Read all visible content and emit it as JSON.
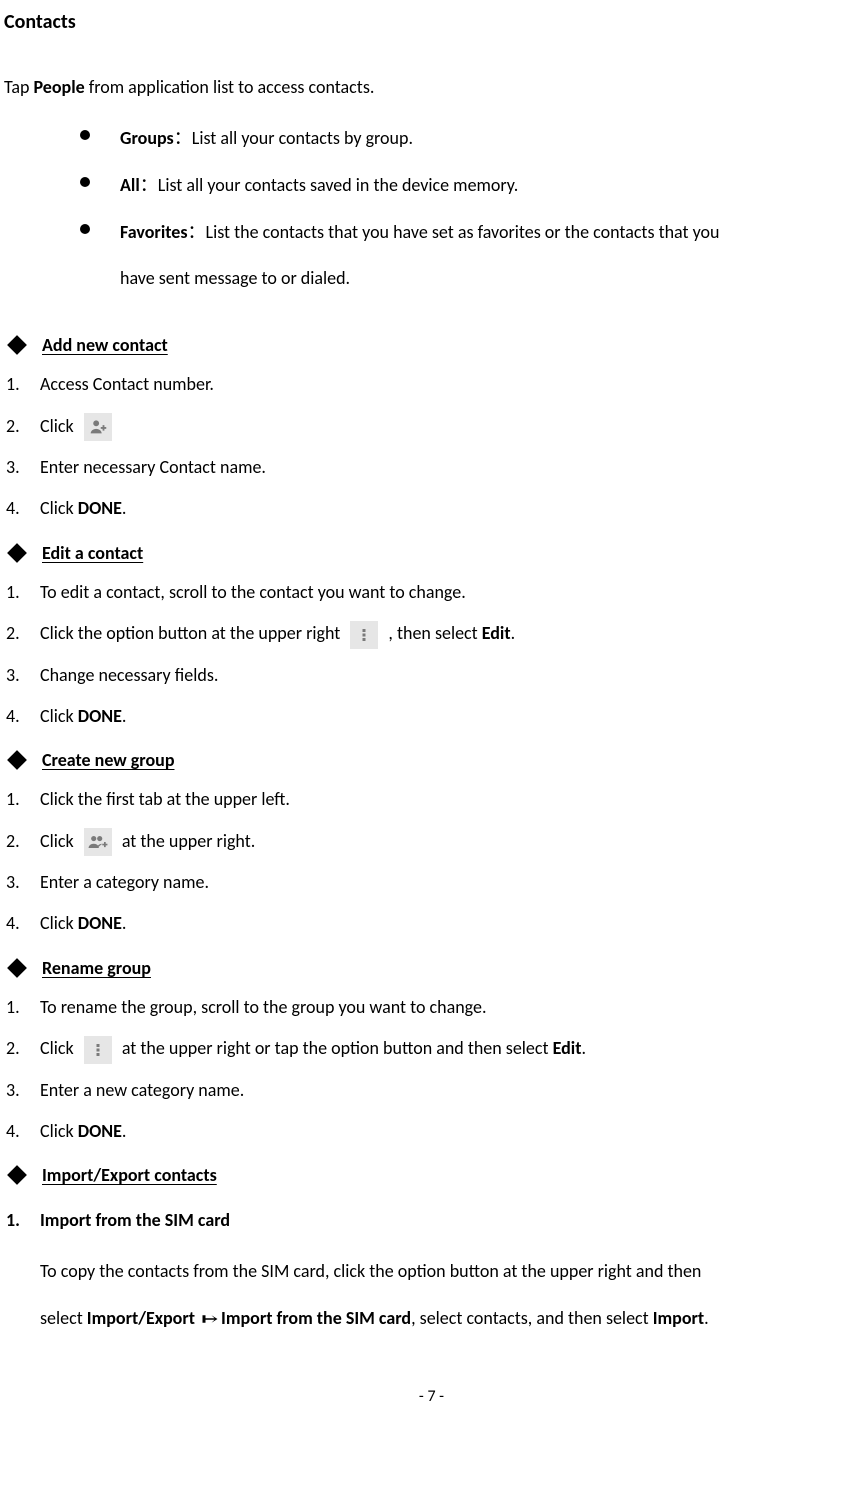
{
  "title": "Contacts",
  "intro": {
    "pre": "Tap ",
    "bold": "People",
    "post": " from application list to access contacts."
  },
  "bullets": [
    {
      "bold": "Groups",
      "colon": "：",
      "rest": "List all your contacts by group."
    },
    {
      "bold": "All",
      "colon": "：",
      "rest": "List all your contacts saved in the device memory."
    },
    {
      "bold": "Favorites",
      "colon": "：",
      "rest": "List the contacts that you have set as favorites or the contacts that you",
      "cont": "have sent message to or dialed."
    }
  ],
  "sections": {
    "add": {
      "heading": "Add new contact",
      "steps": {
        "s1": "Access Contact number.",
        "s2pre": "Click ",
        "s3": "Enter necessary Contact name.",
        "s4pre": "Click ",
        "s4bold": "DONE",
        "s4post": "."
      }
    },
    "edit": {
      "heading": "Edit a contact",
      "steps": {
        "s1": "To edit a contact, scroll to the contact you want to change.",
        "s2pre": "Click the option button at the upper right ",
        "s2mid": ", then select ",
        "s2bold": "Edit",
        "s2post": ".",
        "s3": "Change necessary fields.",
        "s4pre": "Click ",
        "s4bold": "DONE",
        "s4post": "."
      }
    },
    "create": {
      "heading": "Create new group",
      "steps": {
        "s1": "Click the first tab at the upper left.",
        "s2pre": "Click ",
        "s2post": " at the upper right.",
        "s3": "Enter a category name.",
        "s4pre": "Click ",
        "s4bold": "DONE",
        "s4post": "."
      }
    },
    "rename": {
      "heading": "Rename group",
      "steps": {
        "s1": "To rename the group, scroll to the group you want to change.",
        "s2pre": "Click ",
        "s2mid": " at the upper right or tap the option button and then select ",
        "s2bold": "Edit",
        "s2post": ".",
        "s3": "Enter a new category name.",
        "s4pre": "Click ",
        "s4bold": "DONE",
        "s4post": "."
      }
    },
    "importexport": {
      "heading": "Import/Export contacts",
      "item1": {
        "title": "Import from the SIM card",
        "p1a": "To copy the contacts from the SIM card, click the option button at the upper right and then",
        "p2a": "select ",
        "p2b": "Import/Export ",
        "p2c": "Import from the SIM card",
        "p2d": ", select contacts, and then select ",
        "p2e": "Import",
        "p2f": "."
      }
    }
  },
  "footer": "- 7 -"
}
